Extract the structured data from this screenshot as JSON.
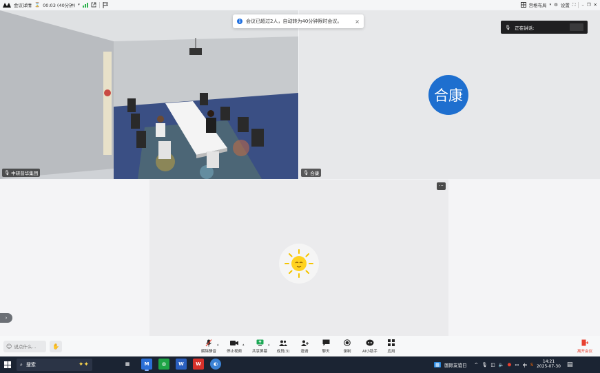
{
  "topbar": {
    "meeting_details": "会议详情",
    "timer": "00:03 (40分钟)",
    "gallery_layout": "宫格布局",
    "settings": "设置"
  },
  "toast": {
    "message": "会议已超过2人，自动转为40分钟限时会议。",
    "close": "×"
  },
  "speaking": {
    "label": "正在讲话:"
  },
  "tiles": [
    {
      "name": "中研普华集团"
    },
    {
      "name": "合康",
      "avatar_text": "合康"
    },
    {
      "name": ""
    }
  ],
  "tile_controls": {
    "more": "···",
    "expand": "›"
  },
  "toolbar": {
    "chat_placeholder": "说点什么...",
    "tools": [
      {
        "label": "解除静音",
        "icon": "mic-muted-icon"
      },
      {
        "label": "停止视频",
        "icon": "camera-icon"
      },
      {
        "label": "共享屏幕",
        "icon": "share-screen-icon"
      },
      {
        "label": "成员(3)",
        "icon": "members-icon"
      },
      {
        "label": "邀请",
        "icon": "invite-icon"
      },
      {
        "label": "聊天",
        "icon": "chat-icon"
      },
      {
        "label": "录制",
        "icon": "record-icon"
      },
      {
        "label": "AI小助手",
        "icon": "ai-assistant-icon"
      },
      {
        "label": "应用",
        "icon": "apps-icon"
      }
    ],
    "leave_label": "离开会议"
  },
  "taskbar": {
    "search_label": "搜索",
    "tray_event": "国际友谊日",
    "ime": "中",
    "time": "14:21",
    "date": "2025-07-30"
  },
  "colors": {
    "accent": "#1e6fcf",
    "leave": "#e8402f",
    "taskbar": "#1b2433"
  }
}
